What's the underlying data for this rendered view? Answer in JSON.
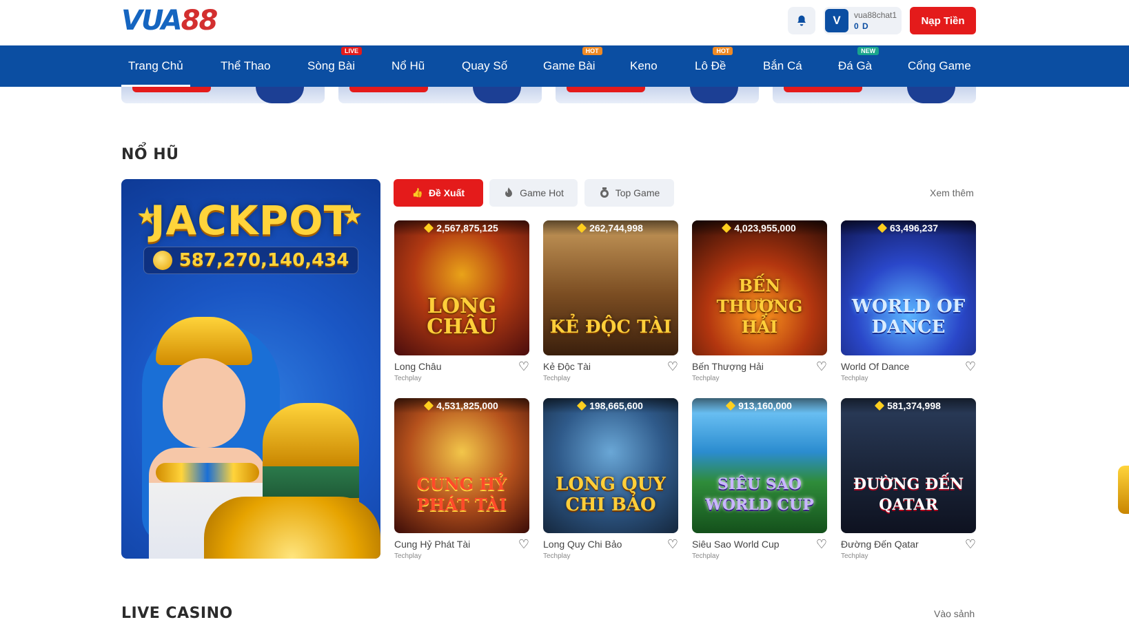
{
  "header": {
    "logo_main": "VUA",
    "logo_num": "88",
    "username": "vua88chat1",
    "balance": "0 D",
    "avatar_letter": "V",
    "deposit_label": "Nạp Tiền"
  },
  "nav": {
    "items": [
      {
        "label": "Trang Chủ",
        "badge": ""
      },
      {
        "label": "Thể Thao",
        "badge": ""
      },
      {
        "label": "Sòng Bài",
        "badge": "LIVE"
      },
      {
        "label": "Nổ Hũ",
        "badge": ""
      },
      {
        "label": "Quay Số",
        "badge": ""
      },
      {
        "label": "Game Bài",
        "badge": "HOT"
      },
      {
        "label": "Keno",
        "badge": ""
      },
      {
        "label": "Lô Đề",
        "badge": "HOT"
      },
      {
        "label": "Bắn Cá",
        "badge": ""
      },
      {
        "label": "Đá Gà",
        "badge": "NEW"
      },
      {
        "label": "Cổng Game",
        "badge": ""
      }
    ]
  },
  "slots": {
    "title": "NỔ HŨ",
    "more_label": "Xem thêm",
    "jackpot_title": "JACKPOT",
    "jackpot_amount": "587,270,140,434",
    "tabs": [
      {
        "label": "Đề Xuất",
        "icon": "thumbs-up-icon"
      },
      {
        "label": "Game Hot",
        "icon": "fire-icon"
      },
      {
        "label": "Top Game",
        "icon": "medal-icon"
      }
    ],
    "games": [
      {
        "name": "Long Châu",
        "provider": "Techplay",
        "jackpot": "2,567,875,125",
        "art_title": "LONG CHÂU"
      },
      {
        "name": "Kẻ Độc Tài",
        "provider": "Techplay",
        "jackpot": "262,744,998",
        "art_title": "KẺ ĐỘC TÀI"
      },
      {
        "name": "Bến Thượng Hải",
        "provider": "Techplay",
        "jackpot": "4,023,955,000",
        "art_title": "BẾN THƯỢNG HẢI"
      },
      {
        "name": "World Of Dance",
        "provider": "Techplay",
        "jackpot": "63,496,237",
        "art_title": "WORLD OF DANCE"
      },
      {
        "name": "Cung Hỷ Phát Tài",
        "provider": "Techplay",
        "jackpot": "4,531,825,000",
        "art_title": "CUNG HỶ PHÁT TÀI"
      },
      {
        "name": "Long Quy Chi Bảo",
        "provider": "Techplay",
        "jackpot": "198,665,600",
        "art_title": "LONG QUY CHI BẢO"
      },
      {
        "name": "Siêu Sao World Cup",
        "provider": "Techplay",
        "jackpot": "913,160,000",
        "art_title": "SIÊU SAO WORLD CUP"
      },
      {
        "name": "Đường Đến Qatar",
        "provider": "Techplay",
        "jackpot": "581,374,998",
        "art_title": "ĐƯỜNG ĐẾN QATAR"
      }
    ]
  },
  "live_casino": {
    "title": "LIVE CASINO",
    "more_label": "Vào sảnh"
  },
  "colors": {
    "brand_blue": "#0b4ea2",
    "brand_red": "#e41b1b",
    "gold": "#ffcf1f"
  }
}
